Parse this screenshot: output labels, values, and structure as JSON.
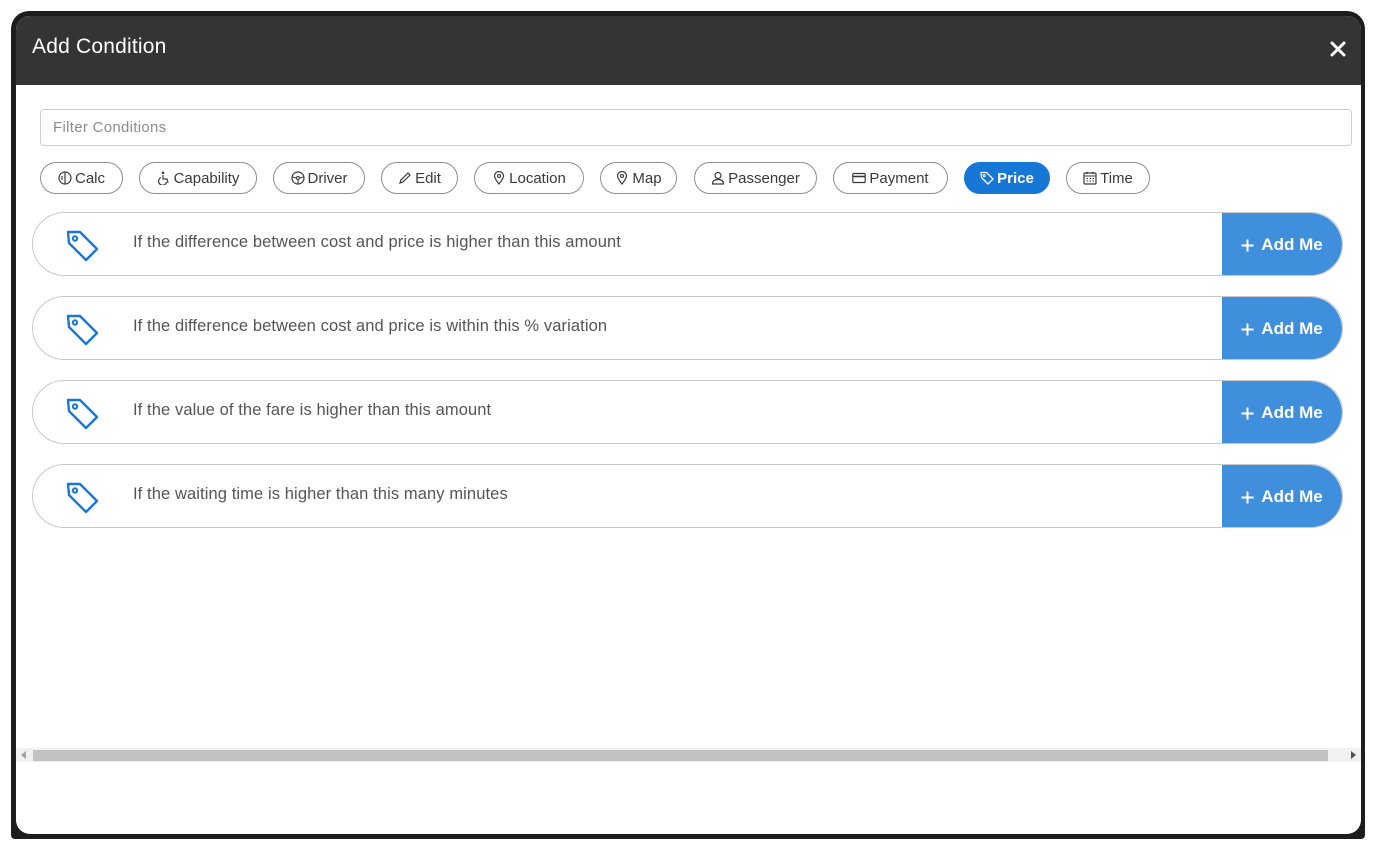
{
  "modal": {
    "title": "Add Condition"
  },
  "filter": {
    "placeholder": "Filter Conditions",
    "value": ""
  },
  "chips": [
    {
      "label": "Calc",
      "icon": "calc-icon",
      "active": false
    },
    {
      "label": "Capability",
      "icon": "wheelchair-icon",
      "active": false
    },
    {
      "label": "Driver",
      "icon": "steering-wheel-icon",
      "active": false
    },
    {
      "label": "Edit",
      "icon": "pencil-icon",
      "active": false
    },
    {
      "label": "Location",
      "icon": "location-pin-icon",
      "active": false
    },
    {
      "label": "Map",
      "icon": "map-pin-icon",
      "active": false
    },
    {
      "label": "Passenger",
      "icon": "person-icon",
      "active": false
    },
    {
      "label": "Payment",
      "icon": "credit-card-icon",
      "active": false
    },
    {
      "label": "Price",
      "icon": "price-tag-icon",
      "active": true
    },
    {
      "label": "Time",
      "icon": "calendar-icon",
      "active": false
    }
  ],
  "conditions": [
    {
      "text": "If the difference between cost and price is higher than this amount",
      "button": "Add Me",
      "icon": "price-tag-icon"
    },
    {
      "text": "If the difference between cost and price is within this % variation",
      "button": "Add Me",
      "icon": "price-tag-icon"
    },
    {
      "text": "If the value of the fare is higher than this amount",
      "button": "Add Me",
      "icon": "price-tag-icon"
    },
    {
      "text": "If the waiting time is higher than this many minutes",
      "button": "Add Me",
      "icon": "price-tag-icon"
    }
  ],
  "colors": {
    "header": "#343434",
    "accent": "#1777d6",
    "add_button": "#3f8fdc"
  }
}
